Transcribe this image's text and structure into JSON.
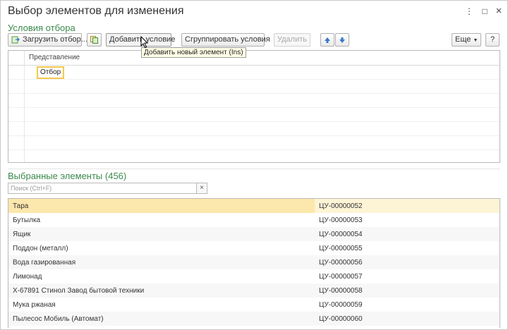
{
  "window": {
    "title": "Выбор элементов для изменения",
    "menu_icon": "⋮",
    "maximize_icon": "□",
    "close_icon": "×"
  },
  "conditions": {
    "title": "Условия отбора",
    "toolbar": {
      "load_label": "Загрузить отбор...",
      "add_label": "Добавить условие",
      "group_label": "Сгруппировать условия",
      "delete_label": "Удалить",
      "more_label": "Еще",
      "help_label": "?"
    },
    "tooltip": "Добавить новый элемент (Ins)",
    "column_header": "Представление",
    "rows": [
      {
        "label": "Отбор"
      }
    ]
  },
  "selected": {
    "title": "Выбранные элементы (456)",
    "search_placeholder": "Поиск (Ctrl+F)",
    "search_clear": "×",
    "items": [
      {
        "name": "Тара",
        "code": "ЦУ-00000052"
      },
      {
        "name": "Бутылка",
        "code": "ЦУ-00000053"
      },
      {
        "name": "Ящик",
        "code": "ЦУ-00000054"
      },
      {
        "name": "Поддон (металл)",
        "code": "ЦУ-00000055"
      },
      {
        "name": "Вода газированная",
        "code": "ЦУ-00000056"
      },
      {
        "name": "Лимонад",
        "code": "ЦУ-00000057"
      },
      {
        "name": "Х-67891 Стинол Завод бытовой техники",
        "code": "ЦУ-00000058"
      },
      {
        "name": "Мука ржаная",
        "code": "ЦУ-00000059"
      },
      {
        "name": "Пылесос Мобиль (Автомат)",
        "code": "ЦУ-00000060"
      }
    ]
  },
  "colors": {
    "section_title": "#3c8a4e",
    "selected_row": "#fce7ac",
    "focus_border": "#f2c94c",
    "arrow_blue": "#3a78c9"
  }
}
